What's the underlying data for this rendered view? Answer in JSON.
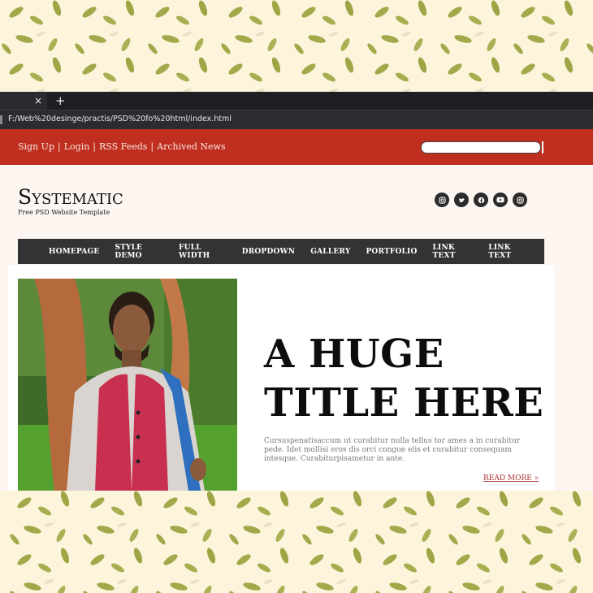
{
  "browser": {
    "tab_close": "×",
    "new_tab": "+",
    "address": "F:/Web%20desinge/practis/PSD%20fo%20html/index.html"
  },
  "topbar": {
    "links": [
      "Sign Up",
      "Login",
      "RSS Feeds",
      "Archived News"
    ],
    "separator": "|",
    "search_value": ""
  },
  "brand": {
    "logo": "Systematic",
    "tagline": "Free PSD Website Template"
  },
  "social": [
    "instagram-icon",
    "twitter-icon",
    "facebook-icon",
    "youtube-icon",
    "instagram-icon"
  ],
  "nav": [
    "HOMEPAGE",
    "STYLE DEMO",
    "FULL WIDTH",
    "DROPDOWN",
    "GALLERY",
    "PORTFOLIO",
    "LINK TEXT",
    "LINK TEXT"
  ],
  "hero": {
    "title_line1": "A HUGE",
    "title_line2": "TITLE HERE",
    "text": "Cursuspenatisaccum ut curabitur nulla tellus tor ames a in curabitur pede. Idet mollisi eros dis orci congue elis et curabitur consequam intesque. Curabiturpisametur in ante.",
    "read_more": "READ MORE »"
  },
  "colors": {
    "topbar": "#bf2e1f",
    "nav": "#333333",
    "background_pattern": "#fdf4dc",
    "leaf": "#a3a84a"
  }
}
